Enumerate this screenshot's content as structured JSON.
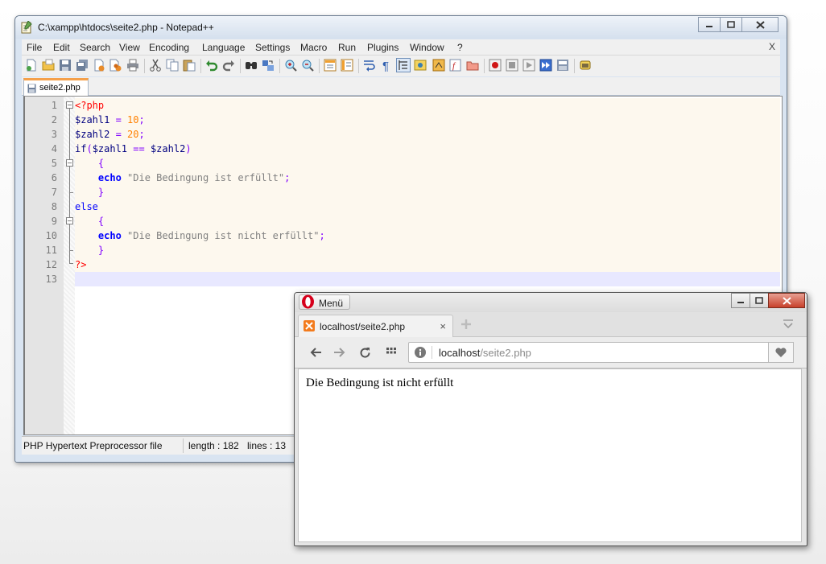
{
  "notepad": {
    "title": "C:\\xampp\\htdocs\\seite2.php - Notepad++",
    "menu": [
      "File",
      "Edit",
      "Search",
      "View",
      "Encoding",
      "Language",
      "Settings",
      "Macro",
      "Run",
      "Plugins",
      "Window",
      "?"
    ],
    "menu_close": "X",
    "tab_label": "seite2.php",
    "line_numbers": [
      "1",
      "2",
      "3",
      "4",
      "5",
      "6",
      "7",
      "8",
      "9",
      "10",
      "11",
      "12",
      "13"
    ],
    "code": {
      "l1_php": "<?php",
      "l2_var": "$zahl1",
      "l2_eq": " = ",
      "l2_num": "10",
      "l2_semi": ";",
      "l3_var": "$zahl2",
      "l3_eq": " = ",
      "l3_num": "20",
      "l3_semi": ";",
      "l4_if": "if",
      "l4_open": "(",
      "l4_var1": "$zahl1",
      "l4_op": " == ",
      "l4_var2": "$zahl2",
      "l4_close": ")",
      "l5_brace": "{",
      "l6_echo": "echo",
      "l6_str": "\"Die Bedingung ist erfüllt\"",
      "l6_semi": ";",
      "l7_brace": "}",
      "l8_else": "else",
      "l9_brace": "{",
      "l10_echo": "echo",
      "l10_str": "\"Die Bedingung ist nicht erfüllt\"",
      "l10_semi": ";",
      "l11_brace": "}",
      "l12_php": "?>"
    },
    "status": {
      "file_type": "PHP Hypertext Preprocessor file",
      "length": "length : 182",
      "lines": "lines : 13"
    }
  },
  "browser": {
    "menu_label": "Menü",
    "tab_label": "localhost/seite2.php",
    "tab_close": "×",
    "address_host": "localhost",
    "address_path": "/seite2.php",
    "page_text": "Die Bedingung ist nicht erfüllt"
  },
  "colors": {
    "php_tag": "#ff0000",
    "variable": "#000080",
    "number": "#ff8000",
    "operator": "#8000ff",
    "keyword": "#0000ff",
    "string": "#808080",
    "tab_accent": "#f5a04a",
    "xampp_orange": "#f37b1d"
  },
  "icons": [
    "notepadpp-icon",
    "new-file-icon",
    "open-icon",
    "save-icon",
    "save-all-icon",
    "close-icon",
    "close-all-icon",
    "print-icon",
    "cut-icon",
    "copy-icon",
    "paste-icon",
    "undo-icon",
    "redo-icon",
    "find-icon",
    "replace-icon",
    "zoom-in-icon",
    "zoom-out-icon",
    "sync-v-icon",
    "sync-h-icon",
    "wrap-icon",
    "all-chars-icon",
    "indent-guide-icon",
    "user-lang-icon",
    "doc-map-icon",
    "function-list-icon",
    "folder-workspace-icon",
    "record-macro-icon",
    "stop-macro-icon",
    "play-macro-icon",
    "run-macro-multiple-icon",
    "save-macro-icon",
    "plugin-icon",
    "opera-logo-icon",
    "xampp-icon",
    "new-tab-icon",
    "tab-menu-icon",
    "back-icon",
    "forward-icon",
    "reload-icon",
    "speed-dial-icon",
    "site-info-icon",
    "bookmark-heart-icon"
  ]
}
